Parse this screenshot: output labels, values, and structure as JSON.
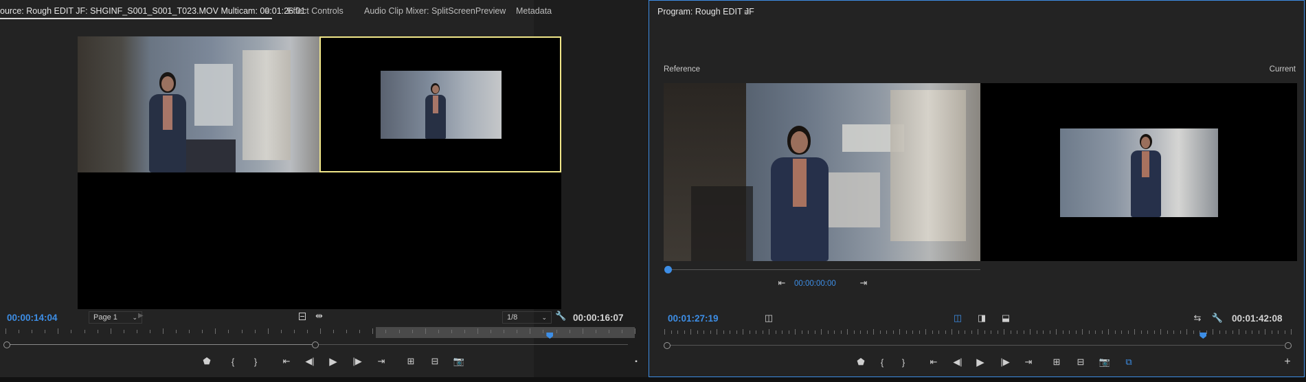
{
  "source_monitor": {
    "tabs": [
      {
        "label": "ource: Rough EDIT JF: SHGINF_S001_S001_T023.MOV Multicam: 00:01:26:01",
        "active": true
      },
      {
        "label": "Effect Controls"
      },
      {
        "label": "Audio Clip Mixer: SplitScreenPreview"
      },
      {
        "label": "Metadata"
      }
    ],
    "menu_icon": "≡",
    "timecode_current": "00:00:14:04",
    "page_select": "Page 1",
    "resolution_select": "1/8",
    "timecode_duration": "00:00:16:07",
    "controls": [
      "marker-icon",
      "mark-in-icon",
      "mark-out-icon",
      "go-to-in-icon",
      "step-back-icon",
      "play-icon",
      "step-forward-icon",
      "go-to-out-icon",
      "insert-icon",
      "overwrite-icon",
      "export-frame-icon"
    ],
    "playhead_fraction": 0.865
  },
  "program_monitor": {
    "tab_label": "Program: Rough EDIT JF",
    "menu_icon": "≡",
    "compare_left_label": "Reference",
    "compare_right_label": "Current",
    "reference_timecode": "00:00:00:00",
    "timecode_current": "00:01:27:19",
    "timecode_duration": "00:01:42:08",
    "controls": [
      "marker-icon",
      "mark-in-icon",
      "mark-out-icon",
      "go-to-in-icon",
      "step-back-icon",
      "play-icon",
      "step-forward-icon",
      "go-to-out-icon",
      "lift-icon",
      "extract-icon",
      "export-frame-icon",
      "comparison-view-icon"
    ],
    "playhead_fraction": 0.86
  },
  "colors": {
    "accent_blue": "#3d8ee6",
    "selection_yellow": "#f2e88a",
    "panel_bg": "#232323",
    "active_panel_border": "#3d8ee6"
  }
}
